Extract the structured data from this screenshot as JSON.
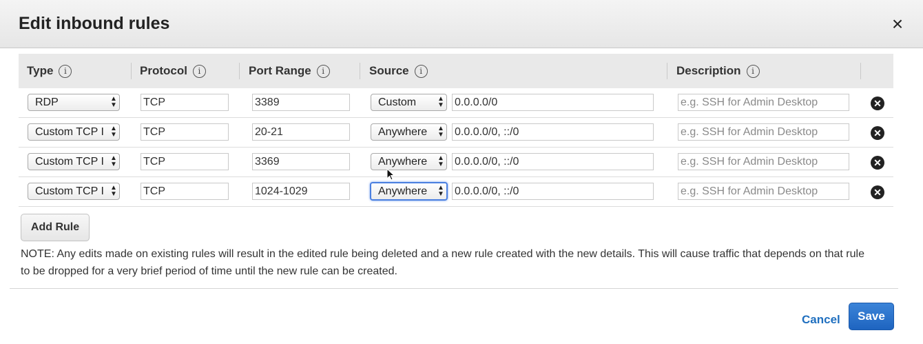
{
  "dialog": {
    "title": "Edit inbound rules",
    "close_icon": "×"
  },
  "table": {
    "headers": {
      "type": "Type",
      "protocol": "Protocol",
      "port_range": "Port Range",
      "source": "Source",
      "description": "Description",
      "info_glyph": "i"
    },
    "rows": [
      {
        "type": "RDP",
        "protocol": "TCP",
        "port_range": "3389",
        "source": "Custom",
        "cidr": "0.0.0.0/0",
        "description": "",
        "description_placeholder": "e.g. SSH for Admin Desktop",
        "delete_glyph": "✕"
      },
      {
        "type": "Custom TCP I",
        "protocol": "TCP",
        "port_range": "20-21",
        "source": "Anywhere",
        "cidr": "0.0.0.0/0, ::/0",
        "description": "",
        "description_placeholder": "e.g. SSH for Admin Desktop",
        "delete_glyph": "✕"
      },
      {
        "type": "Custom TCP I",
        "protocol": "TCP",
        "port_range": "3369",
        "source": "Anywhere",
        "cidr": "0.0.0.0/0, ::/0",
        "description": "",
        "description_placeholder": "e.g. SSH for Admin Desktop",
        "delete_glyph": "✕"
      },
      {
        "type": "Custom TCP I",
        "protocol": "TCP",
        "port_range": "1024-1029",
        "source": "Anywhere",
        "cidr": "0.0.0.0/0, ::/0",
        "description": "",
        "description_placeholder": "e.g. SSH for Admin Desktop",
        "delete_glyph": "✕"
      }
    ]
  },
  "add_rule_label": "Add Rule",
  "note": "NOTE: Any edits made on existing rules will result in the edited rule being deleted and a new rule created with the new details. This will cause traffic that depends on that rule to be dropped for a very brief period of time until the new rule can be created.",
  "footer": {
    "cancel_label": "Cancel",
    "save_label": "Save"
  },
  "colors": {
    "primary_button": "#1e64c0",
    "link": "#1f6fbf",
    "focus_ring": "#4a7fe0"
  }
}
